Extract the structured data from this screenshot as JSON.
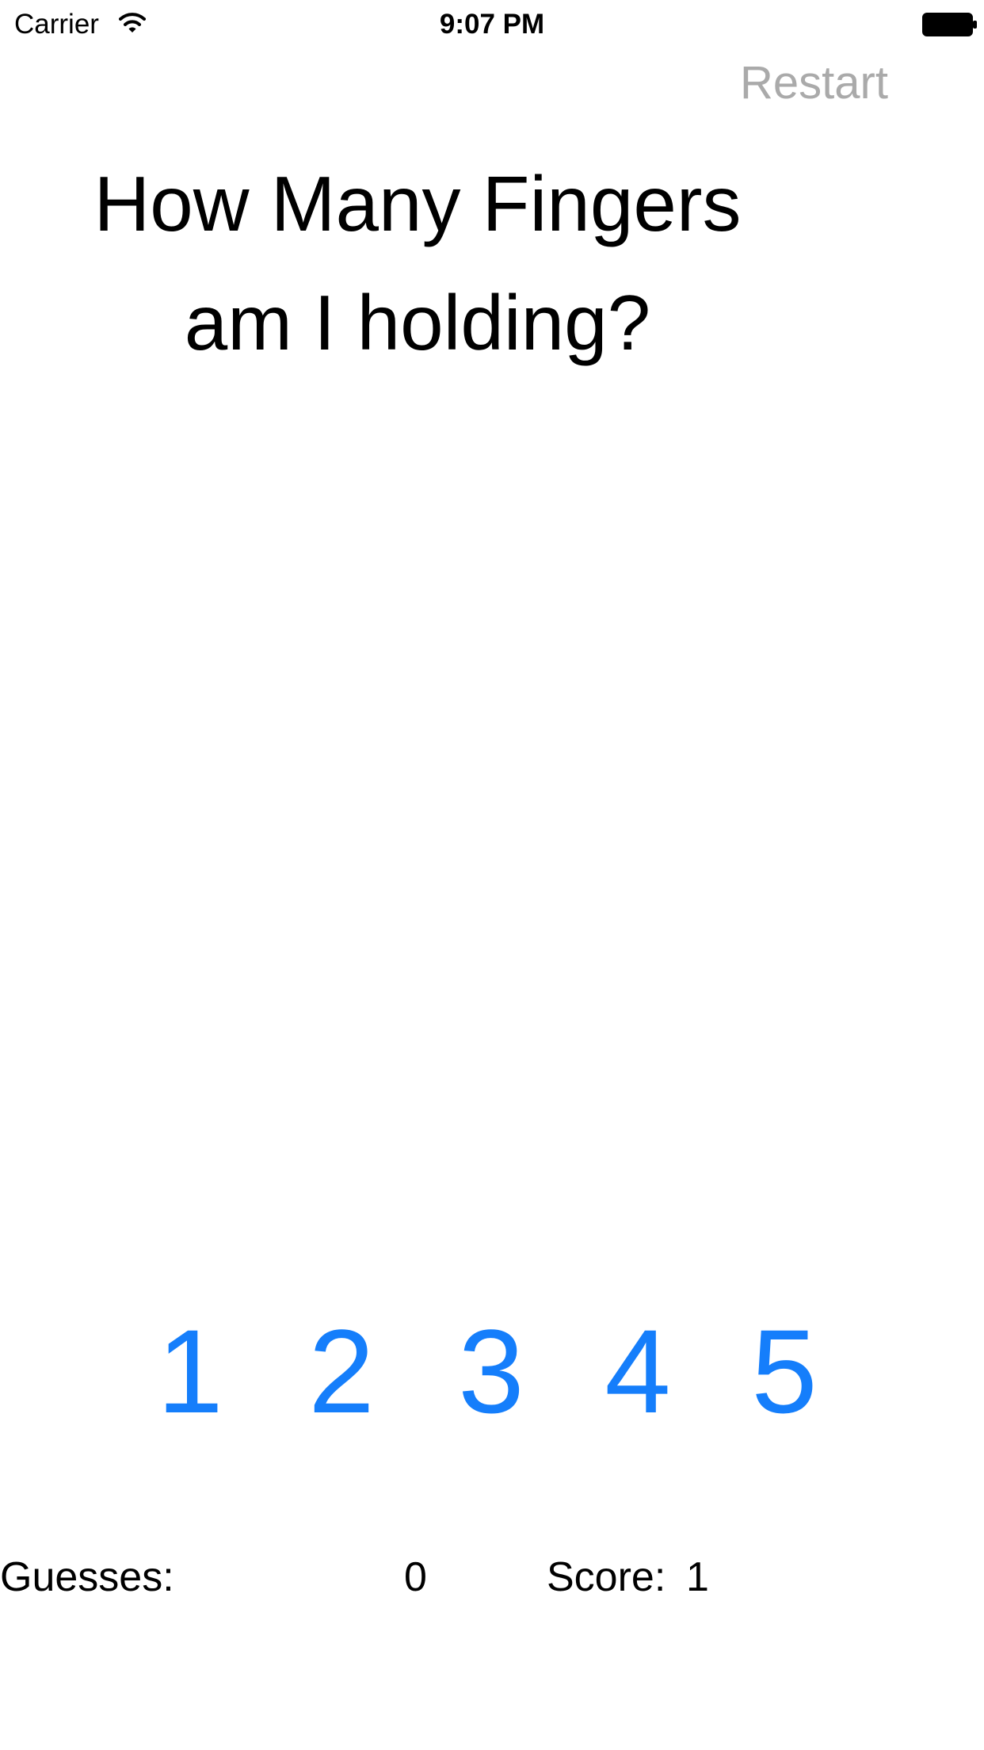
{
  "status_bar": {
    "carrier": "Carrier",
    "time": "9:07 PM",
    "wifi_icon": "wifi-icon",
    "battery_icon": "battery-icon"
  },
  "toolbar": {
    "restart_label": "Restart",
    "restart_color": "#aaaaaa"
  },
  "title": {
    "line1": "How Many Fingers",
    "line2": "am I holding?"
  },
  "guess_buttons": {
    "color": "#157efb",
    "labels": [
      "1",
      "2",
      "3",
      "4",
      "5"
    ]
  },
  "stats": {
    "guesses_label": "Guesses:",
    "guesses_value": "0",
    "score_label": "Score:",
    "score_value": "1"
  }
}
